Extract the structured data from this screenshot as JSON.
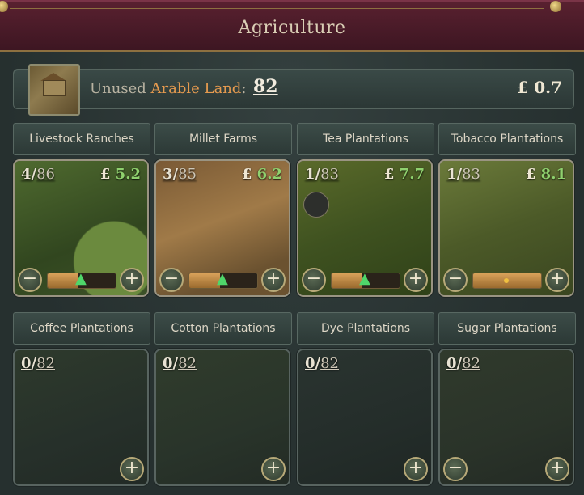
{
  "window": {
    "title": "Agriculture"
  },
  "arable": {
    "label_prefix": "Unused",
    "label_highlight": "Arable Land",
    "label_suffix": ":",
    "value": "82",
    "money": "£ 0.7"
  },
  "buildings": [
    {
      "name": "Livestock Ranches",
      "level": "4",
      "max": "86",
      "profit": "5.2",
      "currency": "£",
      "progress": 0.45,
      "arrow": true,
      "minus": true
    },
    {
      "name": "Millet Farms",
      "level": "3",
      "max": "85",
      "profit": "6.2",
      "currency": "£",
      "progress": 0.45,
      "arrow": true,
      "minus": true
    },
    {
      "name": "Tea Plantations",
      "level": "1",
      "max": "83",
      "profit": "7.7",
      "currency": "£",
      "progress": 0.45,
      "arrow": true,
      "minus": true
    },
    {
      "name": "Tobacco Plantations",
      "level": "1",
      "max": "83",
      "profit": "8.1",
      "currency": "£",
      "progress": 1.0,
      "arrow": false,
      "minus": true
    },
    {
      "name": "Coffee Plantations",
      "level": "0",
      "max": "82",
      "minus": false
    },
    {
      "name": "Cotton Plantations",
      "level": "0",
      "max": "82",
      "minus": false
    },
    {
      "name": "Dye Plantations",
      "level": "0",
      "max": "82",
      "minus": false
    },
    {
      "name": "Sugar Plantations",
      "level": "0",
      "max": "82",
      "minus": true
    }
  ],
  "icons": {
    "minus": "−",
    "plus": "+",
    "up_arrow": "▲"
  },
  "colors": {
    "title_bar": "#5a2130",
    "accent_gold": "#b7a978",
    "profit_green": "#8fd16e",
    "highlight_orange": "#e59a4f"
  }
}
